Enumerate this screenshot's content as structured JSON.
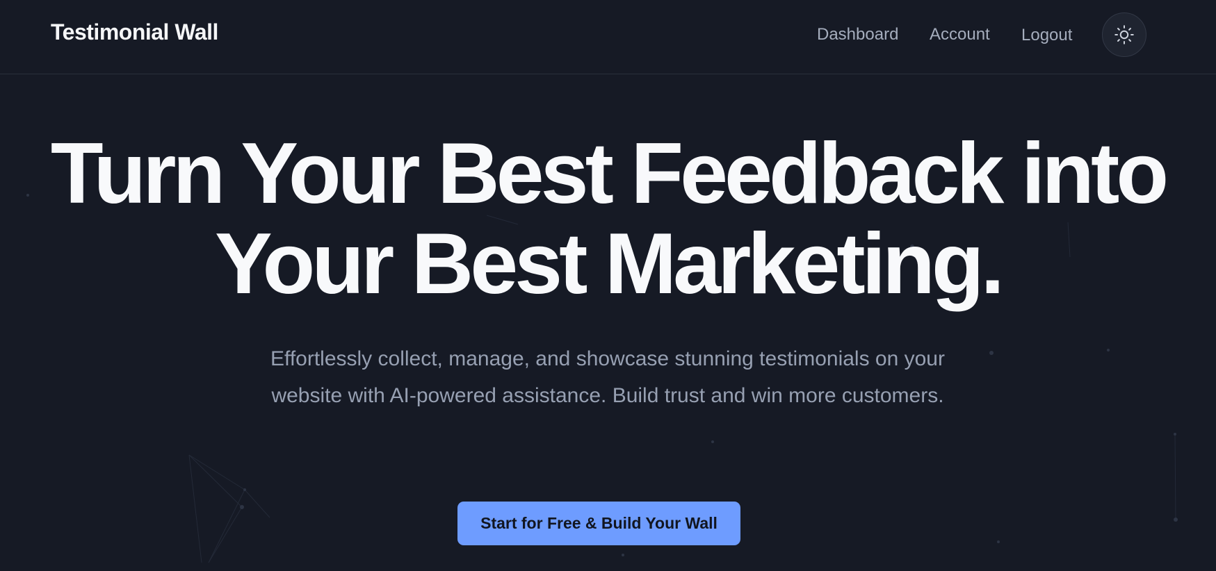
{
  "header": {
    "brand": "Testimonial Wall",
    "nav": {
      "dashboard": "Dashboard",
      "account": "Account",
      "logout": "Logout"
    },
    "theme_toggle_icon": "sun-icon"
  },
  "hero": {
    "title_line1": "Turn Your Best Feedback into",
    "title_line2": "Your Best Marketing.",
    "subtitle": "Effortlessly collect, manage, and showcase stunning testimonials on your website with AI-powered assistance. Build trust and win more customers.",
    "cta_label": "Start for Free & Build Your Wall"
  },
  "colors": {
    "background": "#161a25",
    "accent": "#6e9cff",
    "title": "#f8f9fb",
    "muted_text": "#97a0b2"
  }
}
